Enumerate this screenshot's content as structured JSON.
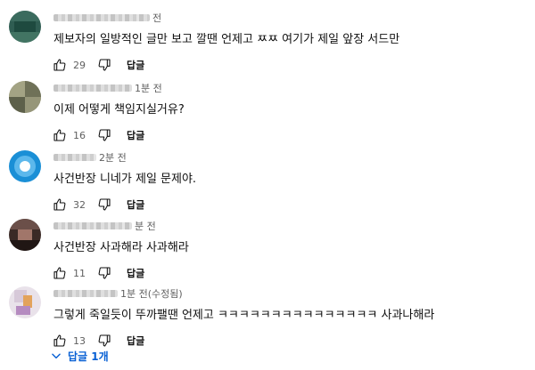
{
  "colors": {
    "link_blue": "#065fd4",
    "meta_gray": "#606060"
  },
  "comments": [
    {
      "time": "전",
      "text": "제보자의 일방적인 글만 보고 깔땐 언제고 ㅉㅉ 여기가 제일 앞장 서드만",
      "likes": "29",
      "reply_label": "답글"
    },
    {
      "time": "1분 전",
      "text": "이제 어떻게 책임지실거유?",
      "likes": "16",
      "reply_label": "답글"
    },
    {
      "time": "2분 전",
      "text": "사건반장 니네가 제일 문제야.",
      "likes": "32",
      "reply_label": "답글"
    },
    {
      "time": "분 전",
      "text": "사건반장 사과해라 사과해라",
      "likes": "11",
      "reply_label": "답글"
    },
    {
      "time": "1분 전(수정됨)",
      "text": "그렇게 죽일듯이 뚜까팰땐 언제고 ㅋㅋㅋㅋㅋㅋㅋㅋㅋㅋㅋㅋㅋㅋㅋ 사과나해라",
      "likes": "13",
      "reply_label": "답글"
    }
  ],
  "replies_toggle": {
    "label": "답글 1개",
    "icon": "chevron-down-icon"
  },
  "icons": {
    "like": "thumb-up-icon",
    "dislike": "thumb-down-icon"
  }
}
